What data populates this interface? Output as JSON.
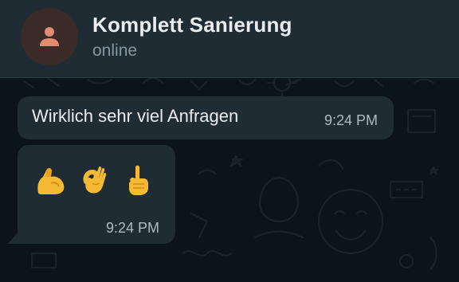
{
  "header": {
    "contact_name": "Komplett Sanierung",
    "status": "online",
    "avatar_icon": "person-icon",
    "avatar_color": "#e28a74"
  },
  "messages": [
    {
      "text": "Wirklich sehr viel Anfragen",
      "time": "9:24 PM"
    },
    {
      "emojis": [
        "flexed-biceps-icon",
        "ok-hand-icon",
        "index-pointing-up-icon"
      ],
      "time": "9:24 PM"
    }
  ],
  "colors": {
    "background": "#0b141a",
    "header": "#1f2c34",
    "bubble": "#202c33",
    "text": "#e9edef",
    "secondary_text": "#8696a0"
  }
}
